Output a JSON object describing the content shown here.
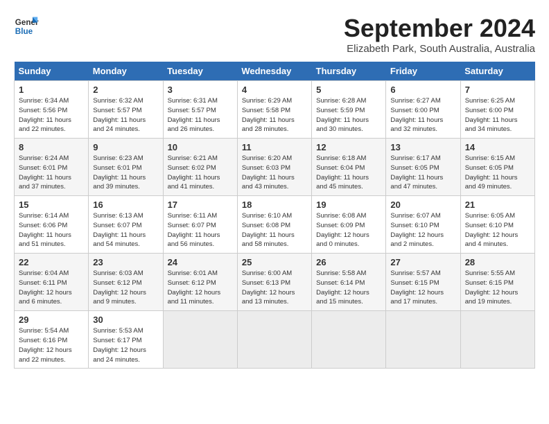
{
  "logo": {
    "line1": "General",
    "line2": "Blue"
  },
  "title": "September 2024",
  "location": "Elizabeth Park, South Australia, Australia",
  "days_of_week": [
    "Sunday",
    "Monday",
    "Tuesday",
    "Wednesday",
    "Thursday",
    "Friday",
    "Saturday"
  ],
  "weeks": [
    [
      {
        "day": "1",
        "info": "Sunrise: 6:34 AM\nSunset: 5:56 PM\nDaylight: 11 hours\nand 22 minutes."
      },
      {
        "day": "2",
        "info": "Sunrise: 6:32 AM\nSunset: 5:57 PM\nDaylight: 11 hours\nand 24 minutes."
      },
      {
        "day": "3",
        "info": "Sunrise: 6:31 AM\nSunset: 5:57 PM\nDaylight: 11 hours\nand 26 minutes."
      },
      {
        "day": "4",
        "info": "Sunrise: 6:29 AM\nSunset: 5:58 PM\nDaylight: 11 hours\nand 28 minutes."
      },
      {
        "day": "5",
        "info": "Sunrise: 6:28 AM\nSunset: 5:59 PM\nDaylight: 11 hours\nand 30 minutes."
      },
      {
        "day": "6",
        "info": "Sunrise: 6:27 AM\nSunset: 6:00 PM\nDaylight: 11 hours\nand 32 minutes."
      },
      {
        "day": "7",
        "info": "Sunrise: 6:25 AM\nSunset: 6:00 PM\nDaylight: 11 hours\nand 34 minutes."
      }
    ],
    [
      {
        "day": "8",
        "info": "Sunrise: 6:24 AM\nSunset: 6:01 PM\nDaylight: 11 hours\nand 37 minutes."
      },
      {
        "day": "9",
        "info": "Sunrise: 6:23 AM\nSunset: 6:01 PM\nDaylight: 11 hours\nand 39 minutes."
      },
      {
        "day": "10",
        "info": "Sunrise: 6:21 AM\nSunset: 6:02 PM\nDaylight: 11 hours\nand 41 minutes."
      },
      {
        "day": "11",
        "info": "Sunrise: 6:20 AM\nSunset: 6:03 PM\nDaylight: 11 hours\nand 43 minutes."
      },
      {
        "day": "12",
        "info": "Sunrise: 6:18 AM\nSunset: 6:04 PM\nDaylight: 11 hours\nand 45 minutes."
      },
      {
        "day": "13",
        "info": "Sunrise: 6:17 AM\nSunset: 6:05 PM\nDaylight: 11 hours\nand 47 minutes."
      },
      {
        "day": "14",
        "info": "Sunrise: 6:15 AM\nSunset: 6:05 PM\nDaylight: 11 hours\nand 49 minutes."
      }
    ],
    [
      {
        "day": "15",
        "info": "Sunrise: 6:14 AM\nSunset: 6:06 PM\nDaylight: 11 hours\nand 51 minutes."
      },
      {
        "day": "16",
        "info": "Sunrise: 6:13 AM\nSunset: 6:07 PM\nDaylight: 11 hours\nand 54 minutes."
      },
      {
        "day": "17",
        "info": "Sunrise: 6:11 AM\nSunset: 6:07 PM\nDaylight: 11 hours\nand 56 minutes."
      },
      {
        "day": "18",
        "info": "Sunrise: 6:10 AM\nSunset: 6:08 PM\nDaylight: 11 hours\nand 58 minutes."
      },
      {
        "day": "19",
        "info": "Sunrise: 6:08 AM\nSunset: 6:09 PM\nDaylight: 12 hours\nand 0 minutes."
      },
      {
        "day": "20",
        "info": "Sunrise: 6:07 AM\nSunset: 6:10 PM\nDaylight: 12 hours\nand 2 minutes."
      },
      {
        "day": "21",
        "info": "Sunrise: 6:05 AM\nSunset: 6:10 PM\nDaylight: 12 hours\nand 4 minutes."
      }
    ],
    [
      {
        "day": "22",
        "info": "Sunrise: 6:04 AM\nSunset: 6:11 PM\nDaylight: 12 hours\nand 6 minutes."
      },
      {
        "day": "23",
        "info": "Sunrise: 6:03 AM\nSunset: 6:12 PM\nDaylight: 12 hours\nand 9 minutes."
      },
      {
        "day": "24",
        "info": "Sunrise: 6:01 AM\nSunset: 6:12 PM\nDaylight: 12 hours\nand 11 minutes."
      },
      {
        "day": "25",
        "info": "Sunrise: 6:00 AM\nSunset: 6:13 PM\nDaylight: 12 hours\nand 13 minutes."
      },
      {
        "day": "26",
        "info": "Sunrise: 5:58 AM\nSunset: 6:14 PM\nDaylight: 12 hours\nand 15 minutes."
      },
      {
        "day": "27",
        "info": "Sunrise: 5:57 AM\nSunset: 6:15 PM\nDaylight: 12 hours\nand 17 minutes."
      },
      {
        "day": "28",
        "info": "Sunrise: 5:55 AM\nSunset: 6:15 PM\nDaylight: 12 hours\nand 19 minutes."
      }
    ],
    [
      {
        "day": "29",
        "info": "Sunrise: 5:54 AM\nSunset: 6:16 PM\nDaylight: 12 hours\nand 22 minutes."
      },
      {
        "day": "30",
        "info": "Sunrise: 5:53 AM\nSunset: 6:17 PM\nDaylight: 12 hours\nand 24 minutes."
      },
      {
        "day": "",
        "info": ""
      },
      {
        "day": "",
        "info": ""
      },
      {
        "day": "",
        "info": ""
      },
      {
        "day": "",
        "info": ""
      },
      {
        "day": "",
        "info": ""
      }
    ]
  ]
}
